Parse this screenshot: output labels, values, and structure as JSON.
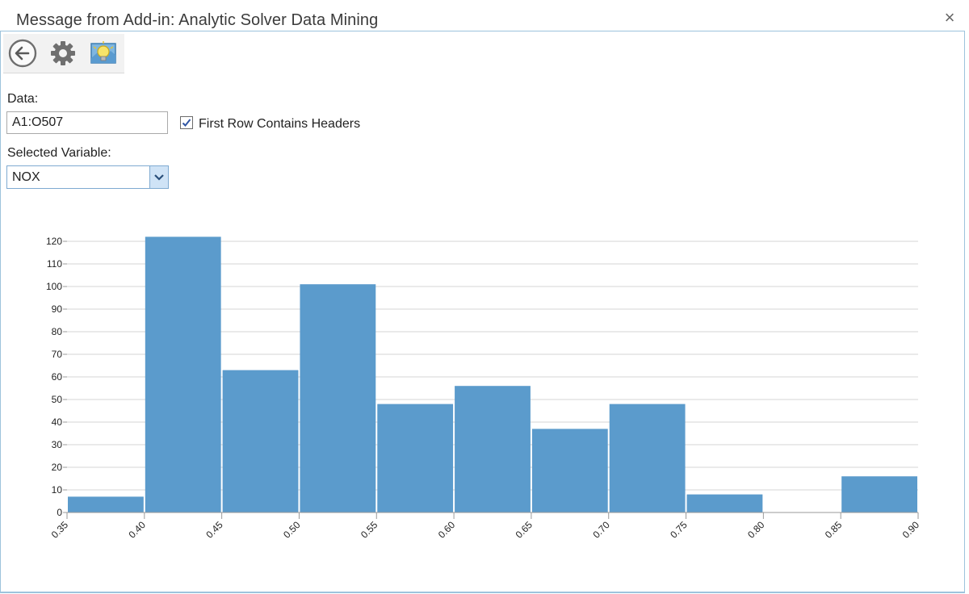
{
  "window": {
    "title": "Message from Add-in: Analytic Solver Data Mining",
    "close_glyph": "×"
  },
  "toolbar": {
    "buttons": [
      {
        "icon": "back-arrow-icon"
      },
      {
        "icon": "gear-icon"
      },
      {
        "icon": "lightbulb-icon"
      }
    ]
  },
  "form": {
    "data_label": "Data:",
    "data_value": "A1:O507",
    "first_row_headers_label": "First Row Contains Headers",
    "first_row_headers_checked": true,
    "selected_variable_label": "Selected Variable:",
    "selected_variable_value": "NOX"
  },
  "colors": {
    "bar": "#5b9bcc",
    "grid": "#d4d4d4",
    "frame": "#9dc3dc",
    "dropdown_arrow_bg": "#cfe3f6"
  },
  "chart_data": {
    "type": "bar",
    "title": "",
    "xlabel": "",
    "ylabel": "",
    "bin_edges": [
      0.35,
      0.4,
      0.45,
      0.5,
      0.55,
      0.6,
      0.65,
      0.7,
      0.75,
      0.8,
      0.85,
      0.9
    ],
    "x_tick_labels": [
      "0.35",
      "0.40",
      "0.45",
      "0.50",
      "0.55",
      "0.60",
      "0.65",
      "0.70",
      "0.75",
      "0.80",
      "0.85",
      "0.90"
    ],
    "values": [
      7,
      122,
      63,
      101,
      48,
      56,
      37,
      48,
      8,
      0,
      16
    ],
    "ylim": [
      0,
      120
    ],
    "y_ticks": [
      0,
      10,
      20,
      30,
      40,
      50,
      60,
      70,
      80,
      90,
      100,
      110,
      120
    ],
    "grid": true,
    "legend": "none"
  }
}
